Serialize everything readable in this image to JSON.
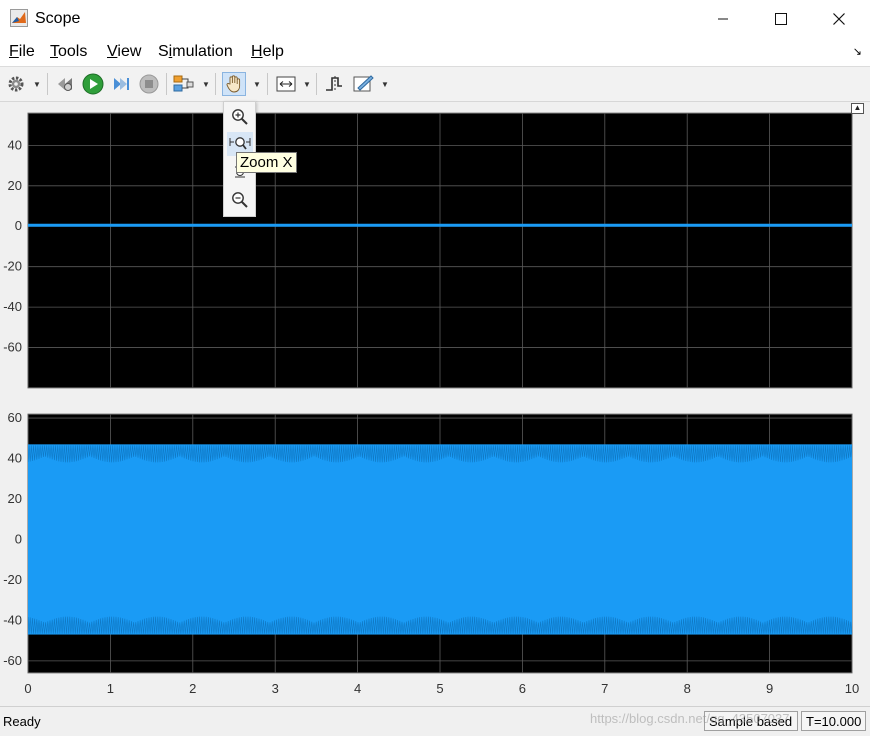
{
  "window": {
    "title": "Scope",
    "icon": "matlab-logo-icon",
    "controls": [
      "minimize-icon",
      "maximize-icon",
      "close-icon"
    ]
  },
  "menu": {
    "items": [
      {
        "mnemonic": "F",
        "rest": "ile"
      },
      {
        "mnemonic": "T",
        "rest": "ools"
      },
      {
        "mnemonic": "V",
        "rest": "iew"
      },
      {
        "pre": "S",
        "mnemonic": "i",
        "rest": "mulation"
      },
      {
        "mnemonic": "H",
        "rest": "elp"
      }
    ],
    "overflow_arrow": "↘"
  },
  "toolbar": {
    "buttons": [
      "settings-gear-icon",
      "step-back-icon",
      "run-icon",
      "step-forward-icon",
      "stop-icon",
      "simulation-mode-icon",
      "pan-hand-icon",
      "scale-axes-icon",
      "triggers-icon",
      "measurements-icon"
    ],
    "active": "pan-hand-icon"
  },
  "zoom_menu": {
    "items": [
      "zoom-in-icon",
      "zoom-x-icon",
      "zoom-y-icon",
      "zoom-out-icon"
    ],
    "highlighted": "zoom-x-icon",
    "tooltip": "Zoom X"
  },
  "colors": {
    "plot_background": "#000000",
    "grid": "#5a5a5a",
    "signal": "#1a9bf5",
    "signal_dark": "#0d6fb8"
  },
  "chart_data": [
    {
      "type": "line",
      "title": "",
      "xlabel": "",
      "ylabel": "",
      "xlim": [
        0,
        10
      ],
      "ylim": [
        -80,
        56
      ],
      "yticks": [
        40,
        20,
        0,
        -20,
        -40,
        -60
      ],
      "xticks": [
        0,
        1,
        2,
        3,
        4,
        5,
        6,
        7,
        8,
        9,
        10
      ],
      "grid": true,
      "series": [
        {
          "x": [
            0,
            10
          ],
          "y": [
            0.5,
            0.5
          ]
        }
      ]
    },
    {
      "type": "area",
      "title": "",
      "xlabel": "",
      "ylabel": "",
      "xlim": [
        0,
        10
      ],
      "ylim": [
        -66,
        62
      ],
      "yticks": [
        60,
        40,
        20,
        0,
        -20,
        -40,
        -60
      ],
      "xticks": [
        0,
        1,
        2,
        3,
        4,
        5,
        6,
        7,
        8,
        9,
        10
      ],
      "grid": true,
      "series": [
        {
          "x": [
            0,
            10
          ],
          "upper": [
            47,
            47
          ],
          "lower": [
            -47,
            -47
          ]
        }
      ]
    }
  ],
  "x_tick_labels": [
    "0",
    "1",
    "2",
    "3",
    "4",
    "5",
    "6",
    "7",
    "8",
    "9",
    "10"
  ],
  "status": {
    "text": "Ready",
    "mode": "Sample based",
    "time": "T=10.000",
    "watermark": "https://blog.csdn.net/qq_43507037"
  }
}
